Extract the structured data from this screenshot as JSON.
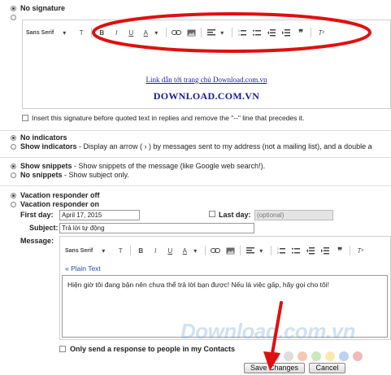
{
  "signature": {
    "no_signature_label": "No signature",
    "font_label": "Sans Serif",
    "link_text": "Link dẫn tới trang chủ Download.com.vn",
    "brand_text": "DOWNLOAD.COM.VN",
    "insert_before_label": "Insert this signature before quoted text in replies and remove the \"--\" line that precedes it."
  },
  "indicators": {
    "no_label": "No indicators",
    "show_label": "Show indicators",
    "show_desc": " - Display an arrow ( › ) by messages sent to my address (not a mailing list), and a double a"
  },
  "snippets": {
    "show_label": "Show snippets",
    "show_desc": " - Show snippets of the message (like Google web search!).",
    "no_label": "No snippets",
    "no_desc": " - Show subject only."
  },
  "vacation": {
    "off_label": "Vacation responder off",
    "on_label": "Vacation responder on",
    "first_day_label": "First day:",
    "first_day_value": "April 17, 2015",
    "last_day_label": "Last day:",
    "last_day_placeholder": "(optional)",
    "subject_label": "Subject:",
    "subject_value": "Trả lời tự động",
    "message_label": "Message:",
    "font_label": "Sans Serif",
    "plain_text_link": "« Plain Text",
    "message_body": "Hiện giờ tôi đang bận nên chưa thể trả lời bạn được! Nếu là việc gấp, hãy gọi cho tôi!",
    "contacts_only_label": "Only send a response to people in my Contacts"
  },
  "buttons": {
    "save": "Save Changes",
    "cancel": "Cancel"
  },
  "watermark": "Download.com.vn",
  "colors": {
    "highlight_ellipse": "#e01010",
    "arrow": "#e01010",
    "link": "#1a1aaa",
    "brand": "#1a1a8c"
  }
}
